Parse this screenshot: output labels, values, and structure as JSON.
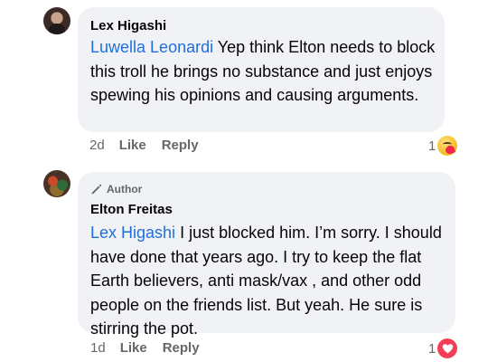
{
  "comments": [
    {
      "author": "Lex Higashi",
      "mention": "Luwella Leonardi",
      "text": " Yep think Elton needs to block this troll he brings no substance and just enjoys spewing his opinions and causing arguments.",
      "time": "2d",
      "like_label": "Like",
      "reply_label": "Reply",
      "reaction_count": "1",
      "reaction_icon": "care-reaction-icon"
    },
    {
      "badge": "Author",
      "author": "Elton Freitas",
      "mention": "Lex Higashi",
      "text": " I just blocked him. I’m sorry. I should have done that years ago. I try to keep the flat Earth believers, anti mask/vax , and other odd people on the friends list. But yeah. He sure is stirring the pot.",
      "time": "1d",
      "like_label": "Like",
      "reply_label": "Reply",
      "reaction_count": "1",
      "reaction_icon": "love-reaction-icon"
    }
  ],
  "colors": {
    "bubble": "#f0f2f5",
    "mention": "#216fdb",
    "meta": "#65676b",
    "text": "#050505"
  }
}
